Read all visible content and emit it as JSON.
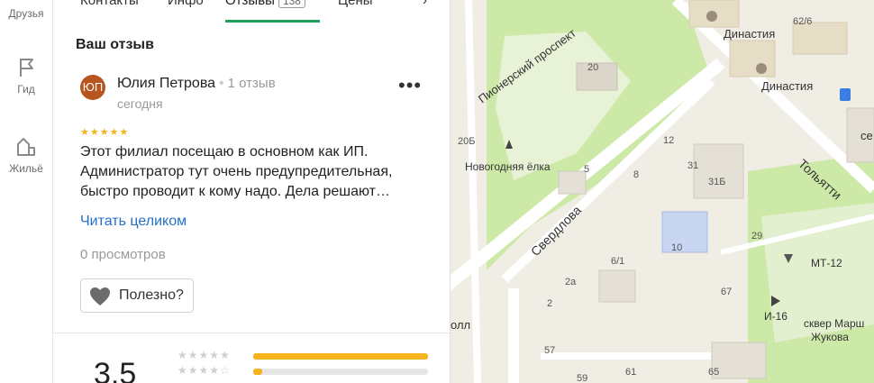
{
  "rail": {
    "friends": "Друзья",
    "guide": "Гид",
    "housing": "Жильё"
  },
  "tabs": {
    "contacts": "Контакты",
    "info": "Инфо",
    "reviews": "Отзывы",
    "reviews_count": "138",
    "prices": "Цены"
  },
  "review": {
    "section_title": "Ваш отзыв",
    "avatar_initials": "ЮП",
    "author": "Юлия Петрова",
    "author_reviews": "1 отзыв",
    "date": "сегодня",
    "rating": 5,
    "text_lines": [
      "Этот филиал посещаю в основном как ИП.",
      "Администратор тут очень предупредительная,",
      "быстро проводит к кому надо. Дела решают…"
    ],
    "read_more": "Читать целиком",
    "views": "0 просмотров",
    "helpful": "Полезно?"
  },
  "summary": {
    "rating": "3,5",
    "distribution": [
      {
        "stars": 5,
        "fraction": 1.0
      },
      {
        "stars": 4,
        "fraction": 0.05
      }
    ]
  },
  "map": {
    "labels": {
      "dynasty1": "Династия",
      "dynasty2": "Династия",
      "pioneer": "Пионерский проспект",
      "sverdlova": "Свердлова",
      "tolyatti": "Тольятти",
      "new_year_tree": "Новогодняя ёлка",
      "mt12": "МТ-12",
      "i16": "И-16",
      "square": "сквер Марш",
      "square2": "Жукова",
      "all": "олл",
      "se": "се"
    },
    "house_numbers": [
      "62/6",
      "20",
      "20Б",
      "5",
      "8",
      "12",
      "31",
      "31Б",
      "29",
      "10",
      "6/1",
      "2а",
      "2",
      "67",
      "57",
      "59",
      "61",
      "65"
    ]
  },
  "colors": {
    "accent_green": "#22a05a",
    "star": "#f5b31e",
    "link": "#2470c8",
    "avatar_bg": "#b8541e"
  }
}
